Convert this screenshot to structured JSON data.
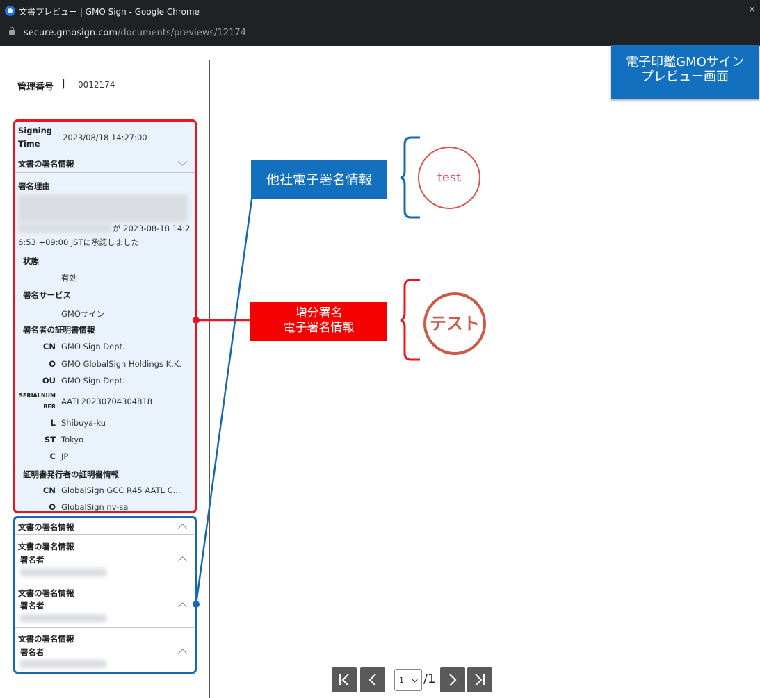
{
  "browser": {
    "window_title": "文書プレビュー | GMO Sign - Google Chrome",
    "url_host": "secure.gmosign.com",
    "url_path": "/documents/previews/12174"
  },
  "management": {
    "label": "管理番号",
    "separator": "|",
    "value": "0012174"
  },
  "signature": {
    "signing_time_label_1": "Signing",
    "signing_time_label_2": "Time",
    "signing_time_value": "2023/08/18 14:27:00",
    "section_title": "文書の署名情報",
    "reason_label": "署名理由",
    "reason_text_1": "が 2023-08-18 14:2",
    "reason_text_2": "6:53 +09:00 JSTに承認しました",
    "status_label": "状態",
    "status_value": "有効",
    "service_label": "署名サービス",
    "service_value": "GMOサイン",
    "signer_cert_label": "署名者の証明書情報",
    "signer_cert": {
      "cn_key": "CN",
      "cn": "GMO Sign Dept.",
      "o_key": "O",
      "o": "GMO GlobalSign Holdings K.K.",
      "ou_key": "OU",
      "ou": "GMO Sign Dept.",
      "serial_key_1": "SERIALNUM",
      "serial_key_2": "BER",
      "serial": "AATL20230704304818",
      "l_key": "L",
      "l": "Shibuya-ku",
      "st_key": "ST",
      "st": "Tokyo",
      "c_key": "C",
      "c": "JP"
    },
    "issuer_cert_label": "証明書発行者の証明書情報",
    "issuer_cert": {
      "cn_key": "CN",
      "cn": "GlobalSign GCC R45 AATL C...",
      "o_key": "O",
      "o": "GlobalSign nv-sa"
    }
  },
  "other_signatures": {
    "header": "文書の署名情報",
    "items": [
      {
        "title": "文書の署名情報",
        "signer_label": "署名者"
      },
      {
        "title": "文書の署名情報",
        "signer_label": "署名者"
      },
      {
        "title": "文書の署名情報",
        "signer_label": "署名者"
      }
    ]
  },
  "pager": {
    "current": "1",
    "total": "/1"
  },
  "annotations": {
    "corner_line_1": "電子印鑑GMOサイン",
    "corner_line_2": "プレビュー画面",
    "blue_label": "他社電子署名情報",
    "red_label_1": "増分署名",
    "red_label_2": "電子署名情報",
    "stamp_latin": "test",
    "stamp_katakana": "テスト"
  },
  "colors": {
    "red_accent": "#e8141f",
    "blue_accent": "#1668b0",
    "panel_bg": "#eaf2fb"
  }
}
